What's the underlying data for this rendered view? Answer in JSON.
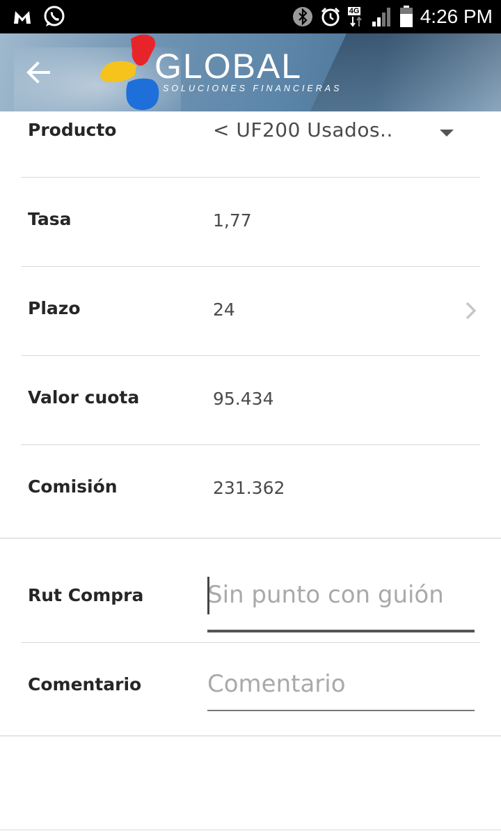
{
  "status_bar": {
    "time": "4:26 PM",
    "network": "4G",
    "icons": [
      "malwarebytes-icon",
      "whatsapp-icon",
      "bluetooth-icon",
      "alarm-icon",
      "network-4g-icon",
      "signal-icon",
      "battery-icon"
    ]
  },
  "header": {
    "brand": "GLOBAL",
    "tagline": "SOLUCIONES FINANCIERAS",
    "back_icon": "back-arrow-icon",
    "logo_colors": [
      "#e8242b",
      "#f6c21c",
      "#1e6fd9"
    ]
  },
  "form": {
    "producto": {
      "label": "Producto",
      "value": "< UF200 Usados.."
    },
    "tasa": {
      "label": "Tasa",
      "value": "1,77"
    },
    "plazo": {
      "label": "Plazo",
      "value": "24"
    },
    "valor_cuota": {
      "label": "Valor cuota",
      "value": "95.434"
    },
    "comision": {
      "label": "Comisión",
      "value": "231.362"
    },
    "rut_compra": {
      "label": "Rut Compra",
      "value": "",
      "placeholder": "Sin punto con guión"
    },
    "comentario": {
      "label": "Comentario",
      "value": "",
      "placeholder": "Comentario"
    }
  }
}
